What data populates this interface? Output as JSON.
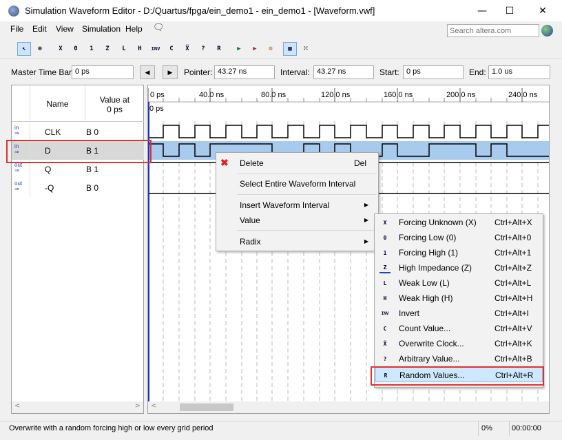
{
  "window": {
    "title": "Simulation Waveform Editor - D:/Quartus/fpga/ein_demo1 - ein_demo1 - [Waveform.vwf]",
    "minimize": "—",
    "maximize": "☐",
    "close": "✕"
  },
  "menubar": {
    "items": [
      "File",
      "Edit",
      "View",
      "Simulation",
      "Help"
    ],
    "search_placeholder": "Search altera.com"
  },
  "toolbar": {
    "icons": [
      "pointer-tool-icon",
      "zoom-tool-icon",
      "forcing-unknown-icon",
      "forcing-low-icon",
      "forcing-high-icon",
      "high-impedance-icon",
      "weak-low-icon",
      "weak-high-icon",
      "invert-icon",
      "count-value-icon",
      "overwrite-clock-icon",
      "arbitrary-value-icon",
      "random-values-icon",
      "run-functional-sim-icon",
      "run-timing-sim-icon",
      "generate-netlist-icon",
      "snap-to-grid-icon",
      "grid-settings-icon"
    ],
    "glyphs": [
      "↖",
      "⊕",
      "X",
      "0",
      "1",
      "Z",
      "L",
      "H",
      "INV",
      "C",
      "X̃",
      "?",
      "R",
      "▶",
      "▶",
      "⚙",
      "▦",
      "⁙"
    ]
  },
  "timebar": {
    "master_label": "Master Time Bar:",
    "master_value": "0 ps",
    "pointer_label": "Pointer:",
    "pointer_value": "43.27 ns",
    "interval_label": "Interval:",
    "interval_value": "43.27 ns",
    "start_label": "Start:",
    "start_value": "0 ps",
    "end_label": "End:",
    "end_value": "1.0 us"
  },
  "signals": {
    "header_name": "Name",
    "header_value": "Value at\n0 ps",
    "rows": [
      {
        "type": "in",
        "name": "CLK",
        "value": "B 0"
      },
      {
        "type": "in",
        "name": "D",
        "value": "B 1"
      },
      {
        "type": "out",
        "name": "Q",
        "value": "B 1"
      },
      {
        "type": "out",
        "name": "-Q",
        "value": "B 0"
      }
    ]
  },
  "timeline": {
    "ticks": [
      "0 ps",
      "40.0 ns",
      "80.0 ns",
      "120.0 ns",
      "160.0 ns",
      "200.0 ns",
      "240.0 ns"
    ],
    "marker_label": "0 ps"
  },
  "context_menu": {
    "delete": "Delete",
    "delete_shortcut": "Del",
    "select_interval": "Select Entire Waveform Interval",
    "insert_interval": "Insert Waveform Interval",
    "value": "Value",
    "radix": "Radix"
  },
  "value_submenu": [
    {
      "icon": "X",
      "label": "Forcing Unknown (X)",
      "shortcut": "Ctrl+Alt+X"
    },
    {
      "icon": "0",
      "label": "Forcing Low (0)",
      "shortcut": "Ctrl+Alt+0"
    },
    {
      "icon": "1",
      "label": "Forcing High (1)",
      "shortcut": "Ctrl+Alt+1"
    },
    {
      "icon": "Z",
      "label": "High Impedance (Z)",
      "shortcut": "Ctrl+Alt+Z"
    },
    {
      "icon": "L",
      "label": "Weak Low (L)",
      "shortcut": "Ctrl+Alt+L"
    },
    {
      "icon": "H",
      "label": "Weak High (H)",
      "shortcut": "Ctrl+Alt+H"
    },
    {
      "icon": "INV",
      "label": "Invert",
      "shortcut": "Ctrl+Alt+I"
    },
    {
      "icon": "C",
      "label": "Count Value...",
      "shortcut": "Ctrl+Alt+V"
    },
    {
      "icon": "X̃",
      "label": "Overwrite Clock...",
      "shortcut": "Ctrl+Alt+K"
    },
    {
      "icon": "?",
      "label": "Arbitrary Value...",
      "shortcut": "Ctrl+Alt+B"
    },
    {
      "icon": "R",
      "label": "Random Values...",
      "shortcut": "Ctrl+Alt+R"
    }
  ],
  "statusbar": {
    "message": "Overwrite with a random forcing high or low every grid period",
    "progress": "0%",
    "time": "00:00:00"
  },
  "colors": {
    "selection": "#a8caed",
    "highlight_box": "#e03030",
    "menu_hover": "#cde8ff"
  }
}
